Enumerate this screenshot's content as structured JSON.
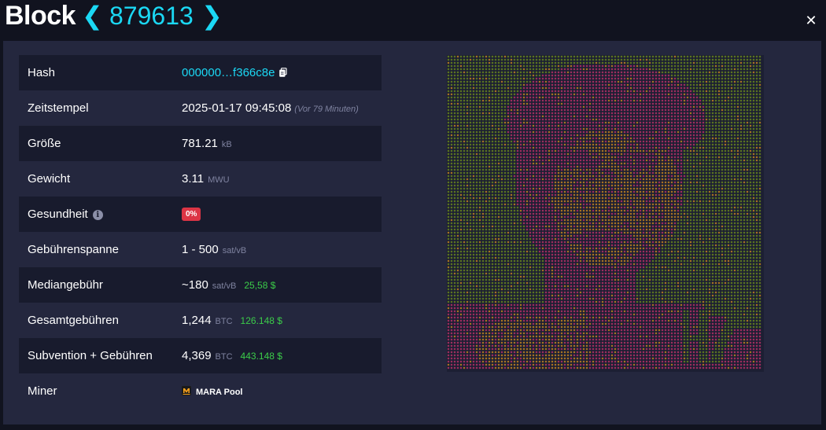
{
  "header": {
    "title": "Block",
    "block_height": "879613",
    "prev_icon": "chevron-left-icon",
    "next_icon": "chevron-right-icon",
    "close_icon": "close-icon"
  },
  "details": {
    "hash": {
      "label": "Hash",
      "value": "000000…f366c8e",
      "icon": "copy-icon"
    },
    "timestamp": {
      "label": "Zeitstempel",
      "value": "2025-01-17 09:45:08",
      "relative": "(Vor 79 Minuten)"
    },
    "size": {
      "label": "Größe",
      "value": "781.21",
      "unit": "kB"
    },
    "weight": {
      "label": "Gewicht",
      "value": "3.11",
      "unit": "MWU"
    },
    "health": {
      "label": "Gesundheit",
      "value": "0%",
      "icon": "info-icon",
      "color": "#dc3545"
    },
    "fee_span": {
      "label": "Gebührenspanne",
      "value": "1 - 500",
      "unit": "sat/vB"
    },
    "median_fee": {
      "label": "Mediangebühr",
      "value": "~180",
      "unit": "sat/vB",
      "usd": "25,58 $"
    },
    "total_fees": {
      "label": "Gesamtgebühren",
      "value": "1,244",
      "unit": "BTC",
      "usd": "126.148 $"
    },
    "subsidy_fees": {
      "label": "Subvention + Gebühren",
      "value": "4,369",
      "unit": "BTC",
      "usd": "443.148 $"
    },
    "miner": {
      "label": "Miner",
      "value": "MARA Pool",
      "icon": "mara-logo-icon"
    }
  },
  "colors": {
    "accent": "#1bd8f4",
    "usd_green": "#3bcc49",
    "badge_red": "#dc3545",
    "viz_green": "#6e8d1a",
    "viz_pink": "#c2316a",
    "viz_orange": "#cf8a1e"
  }
}
